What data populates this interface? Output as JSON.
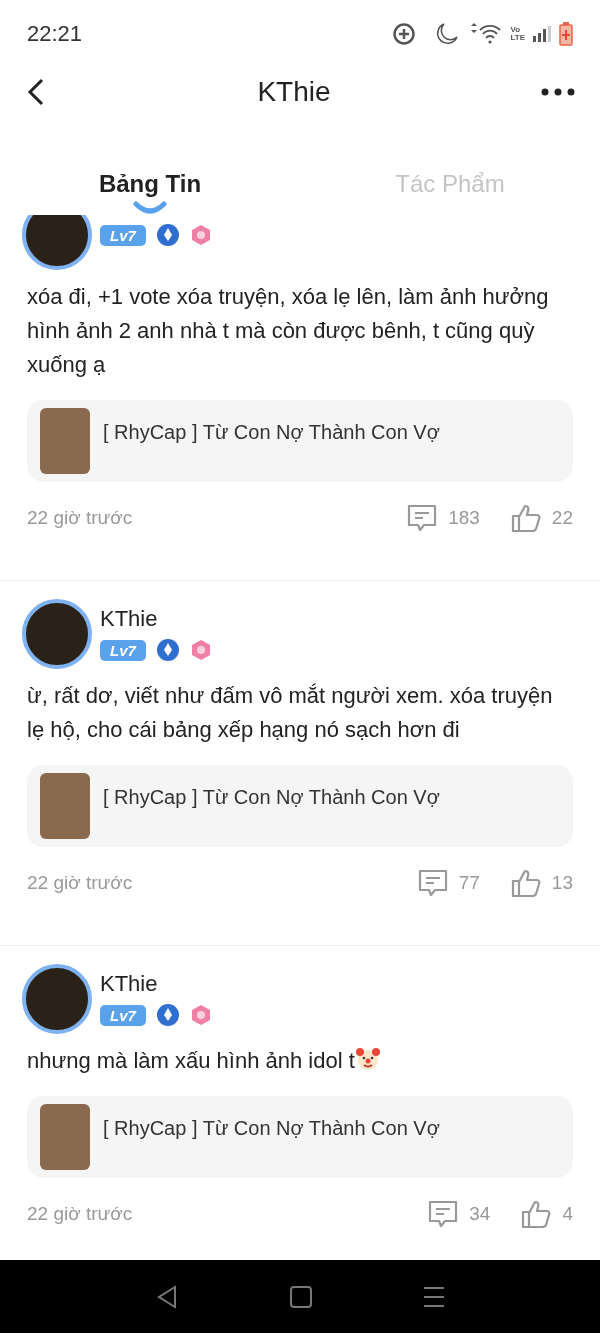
{
  "status_bar": {
    "time": "22:21",
    "network_label": [
      "Vo",
      "LTE"
    ]
  },
  "header": {
    "title": "KThie"
  },
  "tabs": [
    {
      "label": "Bảng Tin",
      "selected": true
    },
    {
      "label": "Tác Phẩm",
      "selected": false
    }
  ],
  "posts": [
    {
      "level": "Lv7",
      "text": "xóa đi, +1 vote xóa truyện, xóa lẹ lên, làm ảnh hưởng hình ảnh 2 anh nhà t mà còn được bênh, t cũng quỳ xuống ạ",
      "emoji": false,
      "story": "[ RhyCap ] Từ Con Nợ Thành Con Vợ",
      "time": "22 giờ trước",
      "comments": "183",
      "likes": "22"
    },
    {
      "name": "KThie",
      "level": "Lv7",
      "text": "ừ, rất dơ, viết như đấm vô mắt người xem. xóa truyện lẹ hộ, cho cái bảng xếp hạng nó sạch hơn đi",
      "emoji": false,
      "story": "[ RhyCap ] Từ Con Nợ Thành Con Vợ",
      "time": "22 giờ trước",
      "comments": "77",
      "likes": "13"
    },
    {
      "name": "KThie",
      "level": "Lv7",
      "text": "nhưng mà làm xấu hình ảnh idol t",
      "emoji": true,
      "story": "[ RhyCap ] Từ Con Nợ Thành Con Vợ",
      "time": "22 giờ trước",
      "comments": "34",
      "likes": "4"
    }
  ]
}
